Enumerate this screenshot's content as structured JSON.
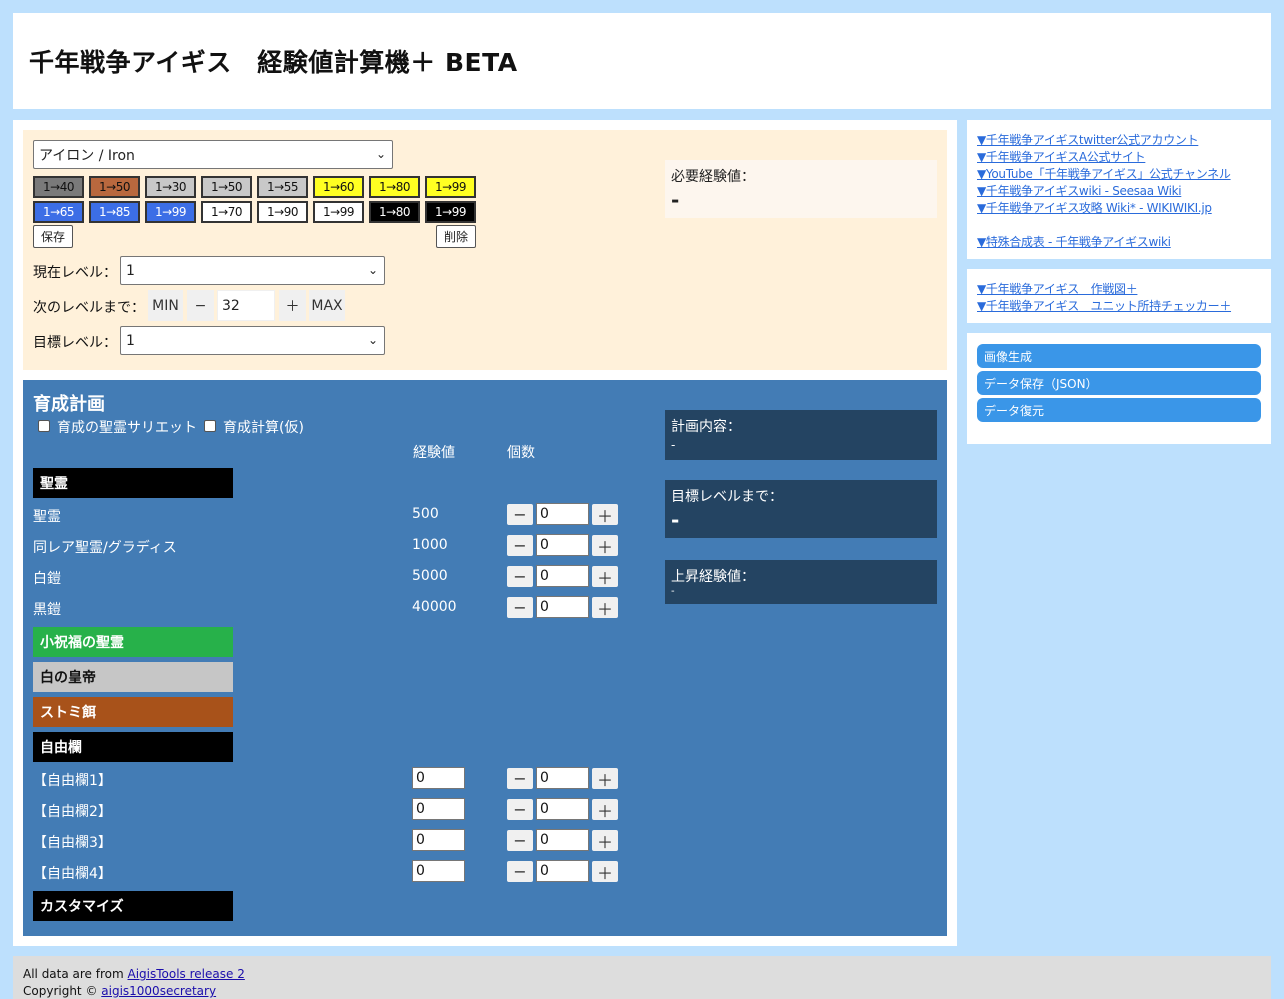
{
  "header": {
    "title": "千年戦争アイギス　経験値計算機＋ BETA"
  },
  "calc": {
    "rarity_selected": "アイロン / Iron",
    "level_buttons_row1": [
      {
        "label": "1→40",
        "bg": "#7a7a7a",
        "fg": "#111"
      },
      {
        "label": "1→50",
        "bg": "#b8683e",
        "fg": "#111"
      },
      {
        "label": "1→30",
        "bg": "#c8c8c8",
        "fg": "#111"
      },
      {
        "label": "1→50",
        "bg": "#c8c8c8",
        "fg": "#111"
      },
      {
        "label": "1→55",
        "bg": "#c8c8c8",
        "fg": "#111"
      },
      {
        "label": "1→60",
        "bg": "#ffff22",
        "fg": "#111"
      },
      {
        "label": "1→80",
        "bg": "#ffff22",
        "fg": "#111"
      },
      {
        "label": "1→99",
        "bg": "#ffff22",
        "fg": "#111"
      }
    ],
    "level_buttons_row2": [
      {
        "label": "1→65",
        "bg": "#3c6ee6",
        "fg": "#fff"
      },
      {
        "label": "1→85",
        "bg": "#3c6ee6",
        "fg": "#fff"
      },
      {
        "label": "1→99",
        "bg": "#3c6ee6",
        "fg": "#fff"
      },
      {
        "label": "1→70",
        "bg": "#ffffff",
        "fg": "#111"
      },
      {
        "label": "1→90",
        "bg": "#ffffff",
        "fg": "#111"
      },
      {
        "label": "1→99",
        "bg": "#ffffff",
        "fg": "#111"
      },
      {
        "label": "1→80",
        "bg": "#000000",
        "fg": "#fff"
      },
      {
        "label": "1→99",
        "bg": "#000000",
        "fg": "#fff"
      }
    ],
    "save_label": "保存",
    "delete_label": "削除",
    "current_level_label": "現在レベル：",
    "current_level_value": "1",
    "next_level_label": "次のレベルまで：",
    "min_label": "MIN",
    "minus": "−",
    "next_value": "32",
    "plus": "＋",
    "max_label": "MAX",
    "target_level_label": "目標レベル：",
    "target_level_value": "1",
    "need_label": "必要経験値：",
    "need_value": "-"
  },
  "plan": {
    "title": "育成計画",
    "check1_label": "育成の聖霊サリエット",
    "check2_label": "育成計算(仮)",
    "col_exp": "経験値",
    "col_count": "個数",
    "cat_seirei": "聖霊",
    "cat_shukufuku": "小祝福の聖霊",
    "cat_koutei": "白の皇帝",
    "cat_sutomi": "ストミ餌",
    "cat_free": "自由欄",
    "cat_custom": "カスタマイズ",
    "rows_seirei": [
      {
        "name": "聖霊",
        "exp": "500",
        "count": "0"
      },
      {
        "name": "同レア聖霊/グラディス",
        "exp": "1000",
        "count": "0"
      },
      {
        "name": "白鎧",
        "exp": "5000",
        "count": "0"
      },
      {
        "name": "黒鎧",
        "exp": "40000",
        "count": "0"
      }
    ],
    "rows_free": [
      {
        "name": "【自由欄1】",
        "exp": "0",
        "count": "0"
      },
      {
        "name": "【自由欄2】",
        "exp": "0",
        "count": "0"
      },
      {
        "name": "【自由欄3】",
        "exp": "0",
        "count": "0"
      },
      {
        "name": "【自由欄4】",
        "exp": "0",
        "count": "0"
      }
    ],
    "minus": "−",
    "plus": "＋",
    "plan_content_label": "計画内容：",
    "plan_content_value": "-",
    "to_target_label": "目標レベルまで：",
    "to_target_value": "-",
    "gain_label": "上昇経験値：",
    "gain_value": "-"
  },
  "side": {
    "links1": [
      "▼千年戦争アイギスtwitter公式アカウント",
      "▼千年戦争アイギスA公式サイト",
      "▼YouTube「千年戦争アイギス」公式チャンネル",
      "▼千年戦争アイギスwiki - Seesaa Wiki",
      "▼千年戦争アイギス攻略 Wiki* - WIKIWIKI.jp"
    ],
    "link_special": "▼特殊合成表 - 千年戦争アイギスwiki",
    "links2": [
      "▼千年戦争アイギス　作戦図＋",
      "▼千年戦争アイギス　ユニット所持チェッカー＋"
    ],
    "buttons": [
      "画像生成",
      "データ保存（JSON）",
      "データ復元"
    ]
  },
  "footer": {
    "data_prefix": "All data are from ",
    "data_link": "AigisTools release 2",
    "copy_prefix": "Copyright © ",
    "copy_link": "aigis1000secretary"
  }
}
